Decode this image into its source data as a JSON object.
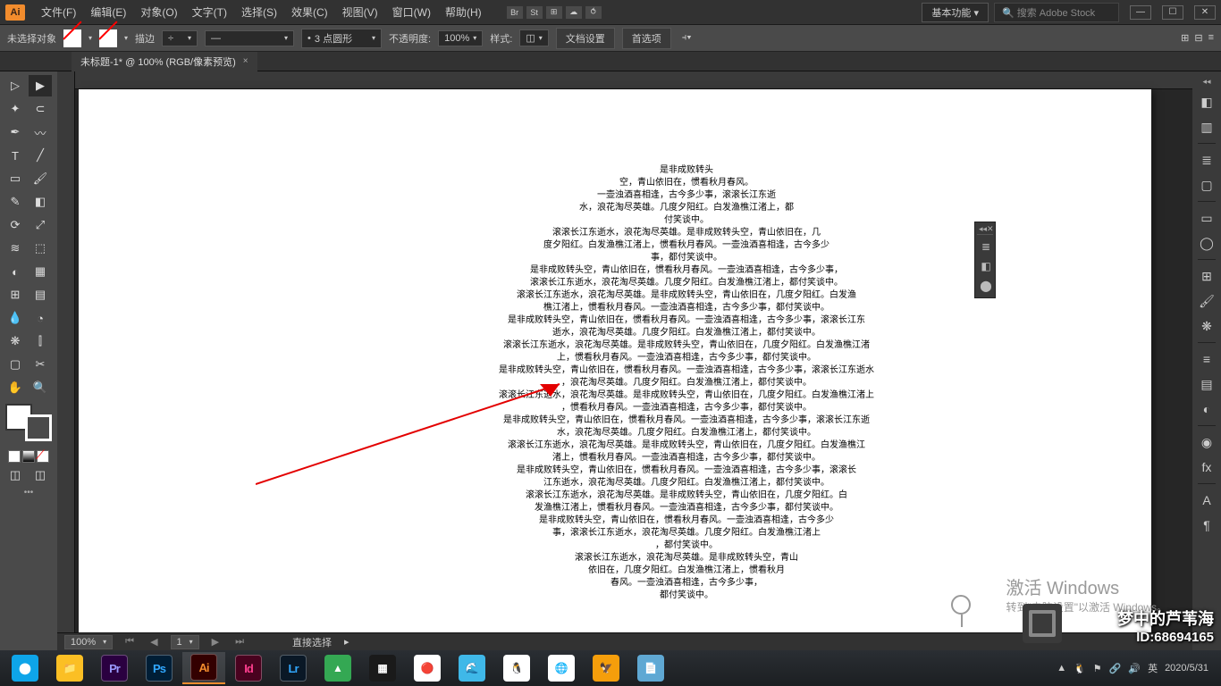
{
  "app": {
    "logo": "Ai"
  },
  "menu": {
    "items": [
      "文件(F)",
      "编辑(E)",
      "对象(O)",
      "文字(T)",
      "选择(S)",
      "效果(C)",
      "视图(V)",
      "窗口(W)",
      "帮助(H)"
    ]
  },
  "topicons": [
    "Br",
    "St",
    "⊞",
    "☁",
    "⥀"
  ],
  "workspace_dd": "基本功能",
  "search_placeholder": "🔍 搜索 Adobe Stock",
  "win": [
    "—",
    "☐",
    "✕"
  ],
  "controlbar": {
    "no_sel": "未选择对象",
    "stroke_label": "描边",
    "stroke_pt": "÷",
    "brush_val": "3 点圆形",
    "opacity_label": "不透明度:",
    "opacity_val": "100%",
    "style_label": "样式:",
    "doc_setup": "文档设置",
    "prefs": "首选项"
  },
  "tab": {
    "title": "未标题-1* @ 100% (RGB/像素预览)",
    "close": "×"
  },
  "floating": {
    "items": [
      "≣",
      "◧",
      "⬤"
    ]
  },
  "rightdock": [
    "prop",
    "lib",
    "sep",
    "layers",
    "artboards",
    "sep",
    "rect",
    "ellipse",
    "sep",
    "swatches",
    "brushes",
    "symbols",
    "sep",
    "stroke",
    "grad",
    "transp",
    "sep",
    "appearance",
    "graphic",
    "sep",
    "char",
    "para"
  ],
  "statusbar": {
    "zoom": "100%",
    "page": "1",
    "tool": "直接选择"
  },
  "textlines": [
    "是非成败转头",
    "空，青山依旧在，惯看秋月春风。",
    "一壶浊酒喜相逢，古今多少事，滚滚长江东逝",
    "水，浪花淘尽英雄。几度夕阳红。白发渔樵江渚上，都",
    "付笑谈中。",
    "滚滚长江东逝水，浪花淘尽英雄。是非成败转头空，青山依旧在，几",
    "度夕阳红。白发渔樵江渚上，惯看秋月春风。一壶浊酒喜相逢，古今多少",
    "事，都付笑谈中。",
    "是非成败转头空，青山依旧在，惯看秋月春风。一壶浊酒喜相逢，古今多少事，",
    "滚滚长江东逝水，浪花淘尽英雄。几度夕阳红。白发渔樵江渚上，都付笑谈中。",
    "滚滚长江东逝水，浪花淘尽英雄。是非成败转头空，青山依旧在，几度夕阳红。白发渔",
    "樵江渚上，惯看秋月春风。一壶浊酒喜相逢，古今多少事，都付笑谈中。",
    "是非成败转头空，青山依旧在，惯看秋月春风。一壶浊酒喜相逢，古今多少事，滚滚长江东",
    "逝水，浪花淘尽英雄。几度夕阳红。白发渔樵江渚上，都付笑谈中。",
    "滚滚长江东逝水，浪花淘尽英雄。是非成败转头空，青山依旧在，几度夕阳红。白发渔樵江渚",
    "上，惯看秋月春风。一壶浊酒喜相逢，古今多少事，都付笑谈中。",
    "是非成败转头空，青山依旧在，惯看秋月春风。一壶浊酒喜相逢，古今多少事，滚滚长江东逝水",
    "，浪花淘尽英雄。几度夕阳红。白发渔樵江渚上，都付笑谈中。",
    "滚滚长江东逝水，浪花淘尽英雄。是非成败转头空，青山依旧在，几度夕阳红。白发渔樵江渚上",
    "，惯看秋月春风。一壶浊酒喜相逢，古今多少事，都付笑谈中。",
    "是非成败转头空，青山依旧在，惯看秋月春风。一壶浊酒喜相逢，古今多少事，滚滚长江东逝",
    "水，浪花淘尽英雄。几度夕阳红。白发渔樵江渚上，都付笑谈中。",
    "滚滚长江东逝水，浪花淘尽英雄。是非成败转头空，青山依旧在，几度夕阳红。白发渔樵江",
    "渚上，惯看秋月春风。一壶浊酒喜相逢，古今多少事，都付笑谈中。",
    "是非成败转头空，青山依旧在，惯看秋月春风。一壶浊酒喜相逢，古今多少事，滚滚长",
    "江东逝水，浪花淘尽英雄。几度夕阳红。白发渔樵江渚上，都付笑谈中。",
    "滚滚长江东逝水，浪花淘尽英雄。是非成败转头空，青山依旧在，几度夕阳红。白",
    "发渔樵江渚上，惯看秋月春风。一壶浊酒喜相逢，古今多少事，都付笑谈中。",
    "是非成败转头空，青山依旧在，惯看秋月春风。一壶浊酒喜相逢，古今多少",
    "事，滚滚长江东逝水，浪花淘尽英雄。几度夕阳红。白发渔樵江渚上",
    "，都付笑谈中。",
    "滚滚长江东逝水，浪花淘尽英雄。是非成败转头空，青山",
    "依旧在，几度夕阳红。白发渔樵江渚上，惯看秋月",
    "春风。一壶浊酒喜相逢，古今多少事，",
    "都付笑谈中。"
  ],
  "watermark": {
    "t1": "激活 Windows",
    "t2": "转到\"电脑设置\"以激活 Windows。"
  },
  "brand": {
    "t1": "梦中的芦苇海",
    "t2": "ID:68694165"
  },
  "taskbar": {
    "apps": [
      {
        "bg": "#0ea5e9",
        "txt": "⬤",
        "name": "browser"
      },
      {
        "bg": "#fbbf24",
        "txt": "📁",
        "name": "explorer"
      },
      {
        "bg": "#2a0040",
        "txt": "Pr",
        "name": "premiere"
      },
      {
        "bg": "#001e36",
        "txt": "Ps",
        "name": "photoshop"
      },
      {
        "bg": "#330000",
        "txt": "Ai",
        "name": "illustrator",
        "active": true
      },
      {
        "bg": "#49021f",
        "txt": "Id",
        "name": "indesign"
      },
      {
        "bg": "#0a1826",
        "txt": "Lr",
        "name": "lightroom"
      },
      {
        "bg": "#34a853",
        "txt": "▲",
        "name": "app1"
      },
      {
        "bg": "#1a1a1a",
        "txt": "▦",
        "name": "app2"
      },
      {
        "bg": "#fff",
        "txt": "🔴",
        "name": "app3"
      },
      {
        "bg": "#3fb8e8",
        "txt": "🌊",
        "name": "app4"
      },
      {
        "bg": "#fff",
        "txt": "🐧",
        "name": "qq"
      },
      {
        "bg": "#fff",
        "txt": "🌐",
        "name": "chrome"
      },
      {
        "bg": "#f59e0b",
        "txt": "🦅",
        "name": "app5"
      },
      {
        "bg": "#5fa8d3",
        "txt": "📄",
        "name": "app6"
      }
    ],
    "date": "2020/5/31"
  }
}
